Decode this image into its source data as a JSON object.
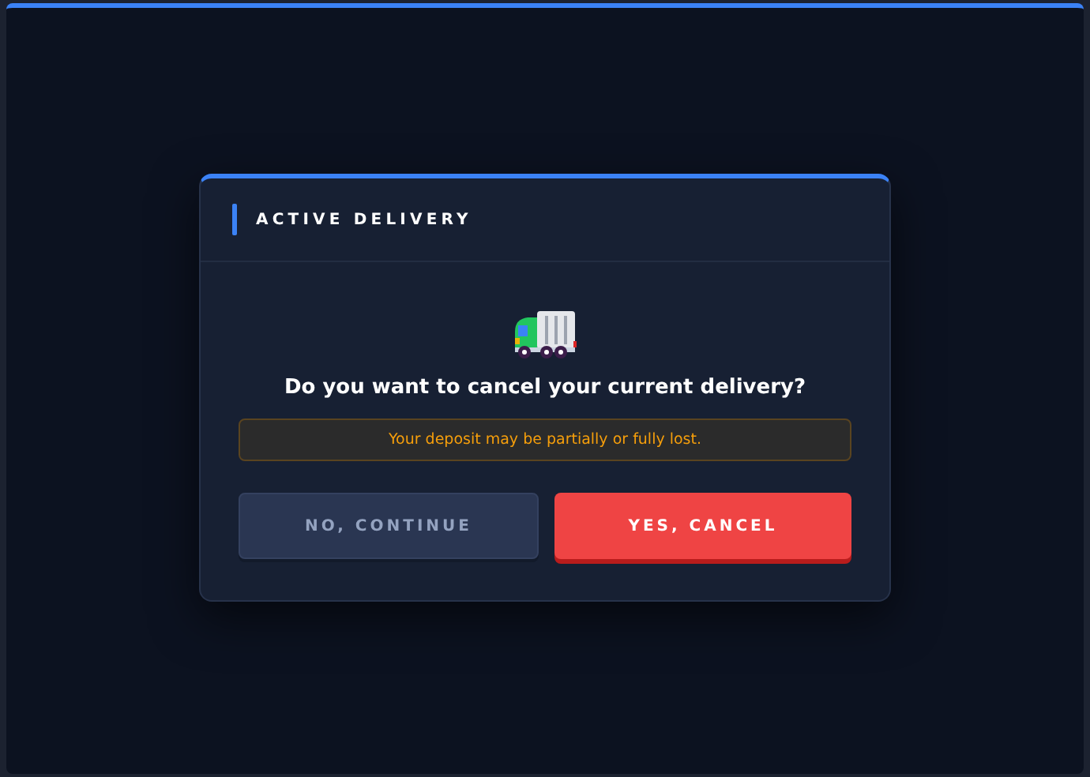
{
  "dialog": {
    "title": "ACTIVE DELIVERY",
    "question": "Do you want to cancel your current delivery?",
    "warning": "Your deposit may be partially or fully lost.",
    "buttons": [
      {
        "label": "NO, CONTINUE",
        "kind": "secondary"
      },
      {
        "label": "YES, CANCEL",
        "kind": "danger"
      }
    ]
  }
}
